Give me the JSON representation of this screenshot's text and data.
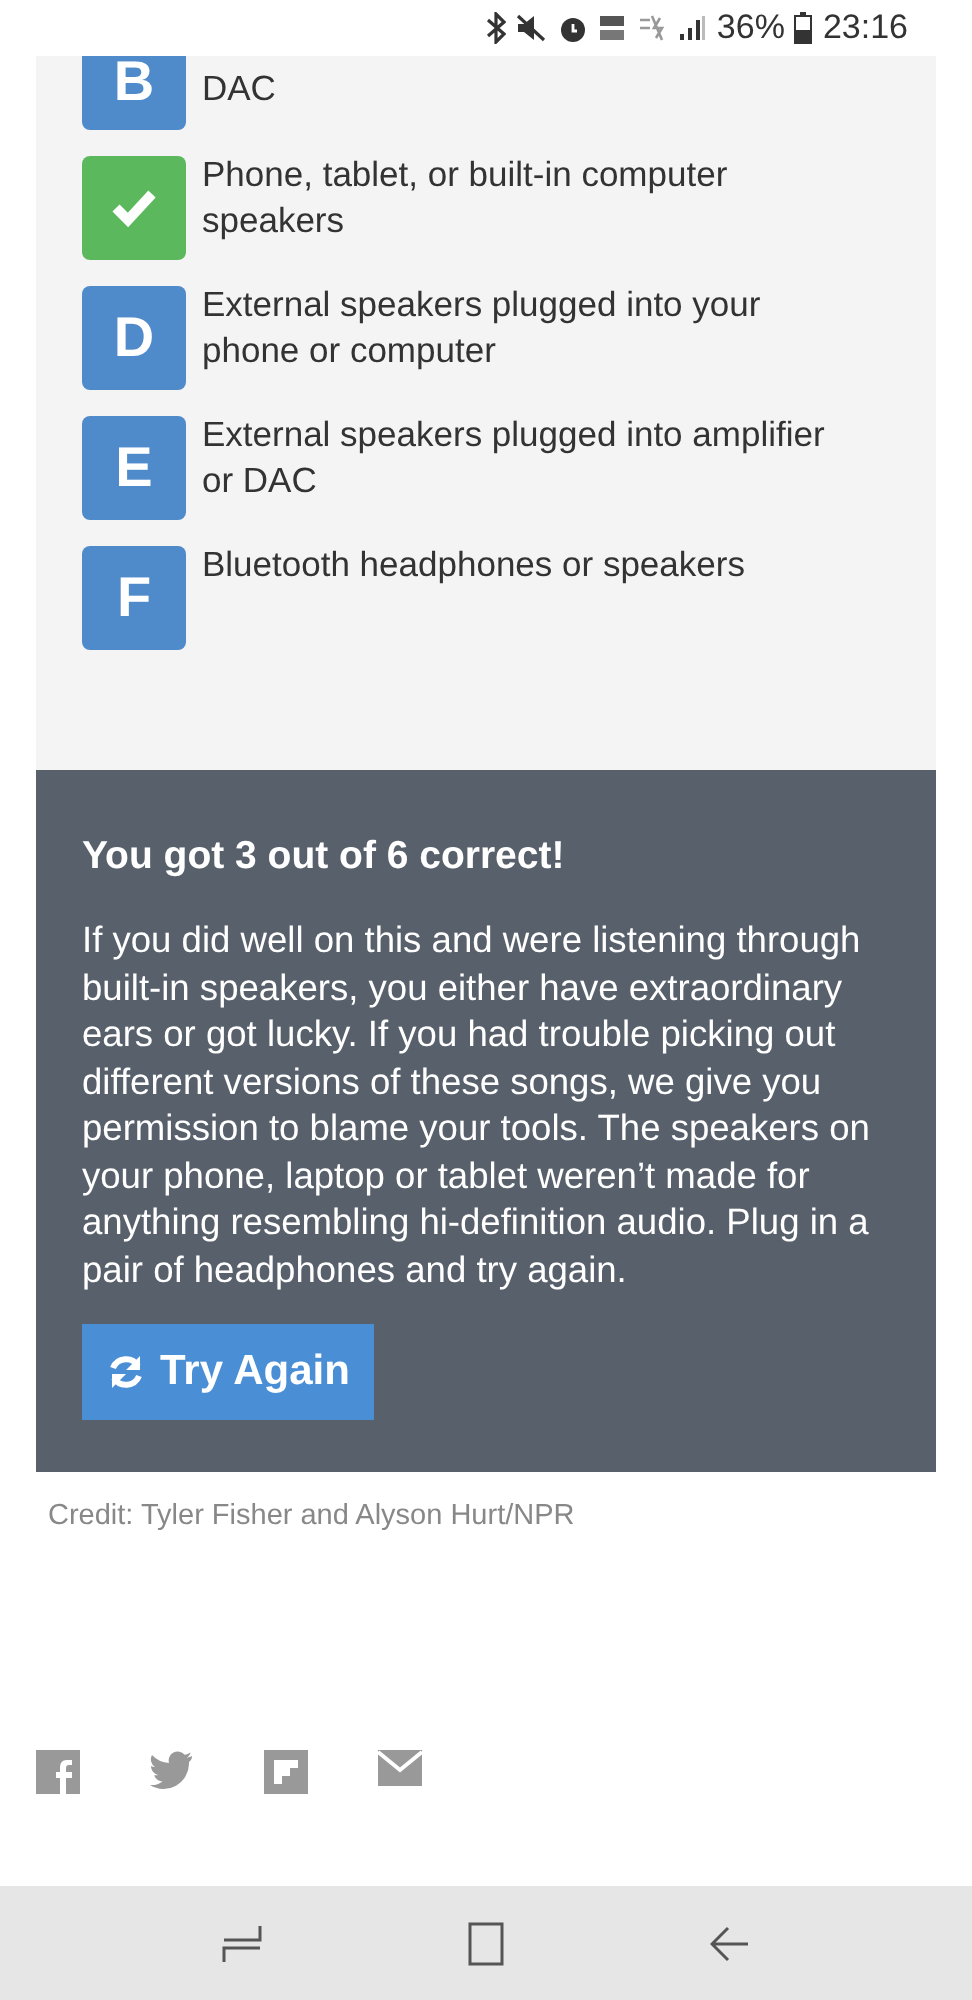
{
  "status_bar": {
    "battery": "36%",
    "time": "23:16"
  },
  "options": [
    {
      "letter": "B",
      "text": "DAC",
      "correct": false
    },
    {
      "text": "Phone, tablet, or built-in computer speakers",
      "correct": true
    },
    {
      "letter": "D",
      "text": "External speakers plugged into your phone or computer",
      "correct": false
    },
    {
      "letter": "E",
      "text": "External speakers plugged into amplifier or DAC",
      "correct": false
    },
    {
      "letter": "F",
      "text": "Bluetooth headphones or speakers",
      "correct": false
    }
  ],
  "result": {
    "heading": "You got 3 out of 6 correct!",
    "body": "If you did well on this and were listening through built-in speakers, you either have extraordinary ears or got lucky. If you had trouble picking out different versions of these songs, we give you permission to blame your tools. The speakers on your phone, laptop or tablet weren’t made for anything resembling hi-definition audio. Plug in a pair of headphones and try again.",
    "button": "Try Again"
  },
  "credit": "Credit: Tyler Fisher and Alyson Hurt/NPR"
}
